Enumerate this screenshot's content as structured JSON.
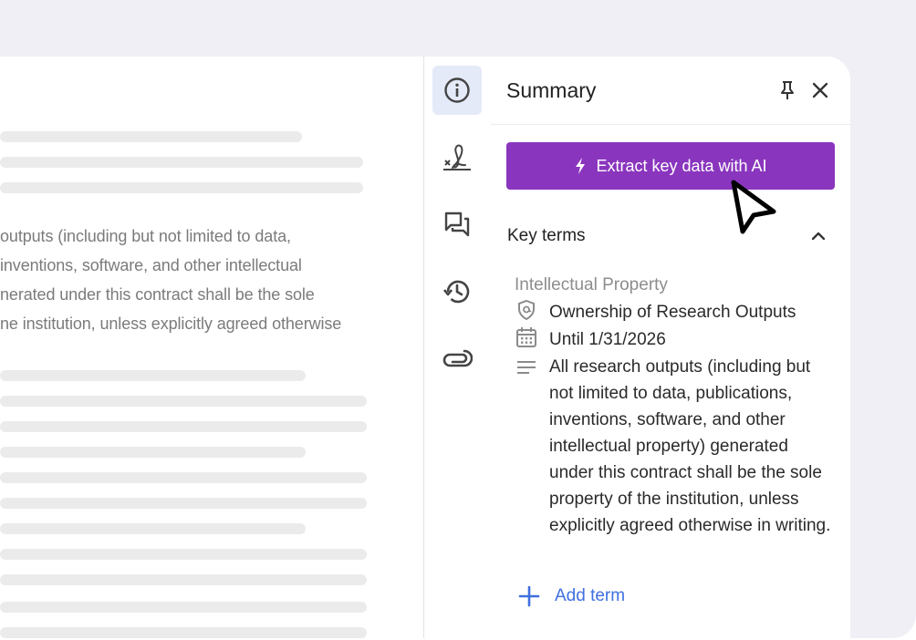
{
  "document": {
    "text_lines": [
      "outputs (including but not limited to data,",
      " inventions, software, and other intellectual",
      "nerated under this contract shall be the sole",
      "ne institution, unless explicitly agreed otherwise"
    ]
  },
  "rail": {
    "items": [
      {
        "icon": "info-icon",
        "active": true
      },
      {
        "icon": "signature-icon",
        "active": false
      },
      {
        "icon": "comments-icon",
        "active": false
      },
      {
        "icon": "history-icon",
        "active": false
      },
      {
        "icon": "attachment-icon",
        "active": false
      }
    ]
  },
  "panel": {
    "title": "Summary",
    "pin_icon": "pin-icon",
    "close_icon": "close-icon",
    "ai_button_label": "Extract key data with AI",
    "ai_button_color": "#8a35be",
    "section_title": "Key terms",
    "term": {
      "category": "Intellectual Property",
      "name": "Ownership of Research Outputs",
      "date": "Until 1/31/2026",
      "description": "All research outputs (including but not limited to data, publications, inventions, software, and other intellectual property) generated under this contract shall be the sole property of the institution, unless explicitly agreed otherwise in writing."
    },
    "add_term_label": "Add term",
    "accent_color": "#3f6fe0"
  }
}
